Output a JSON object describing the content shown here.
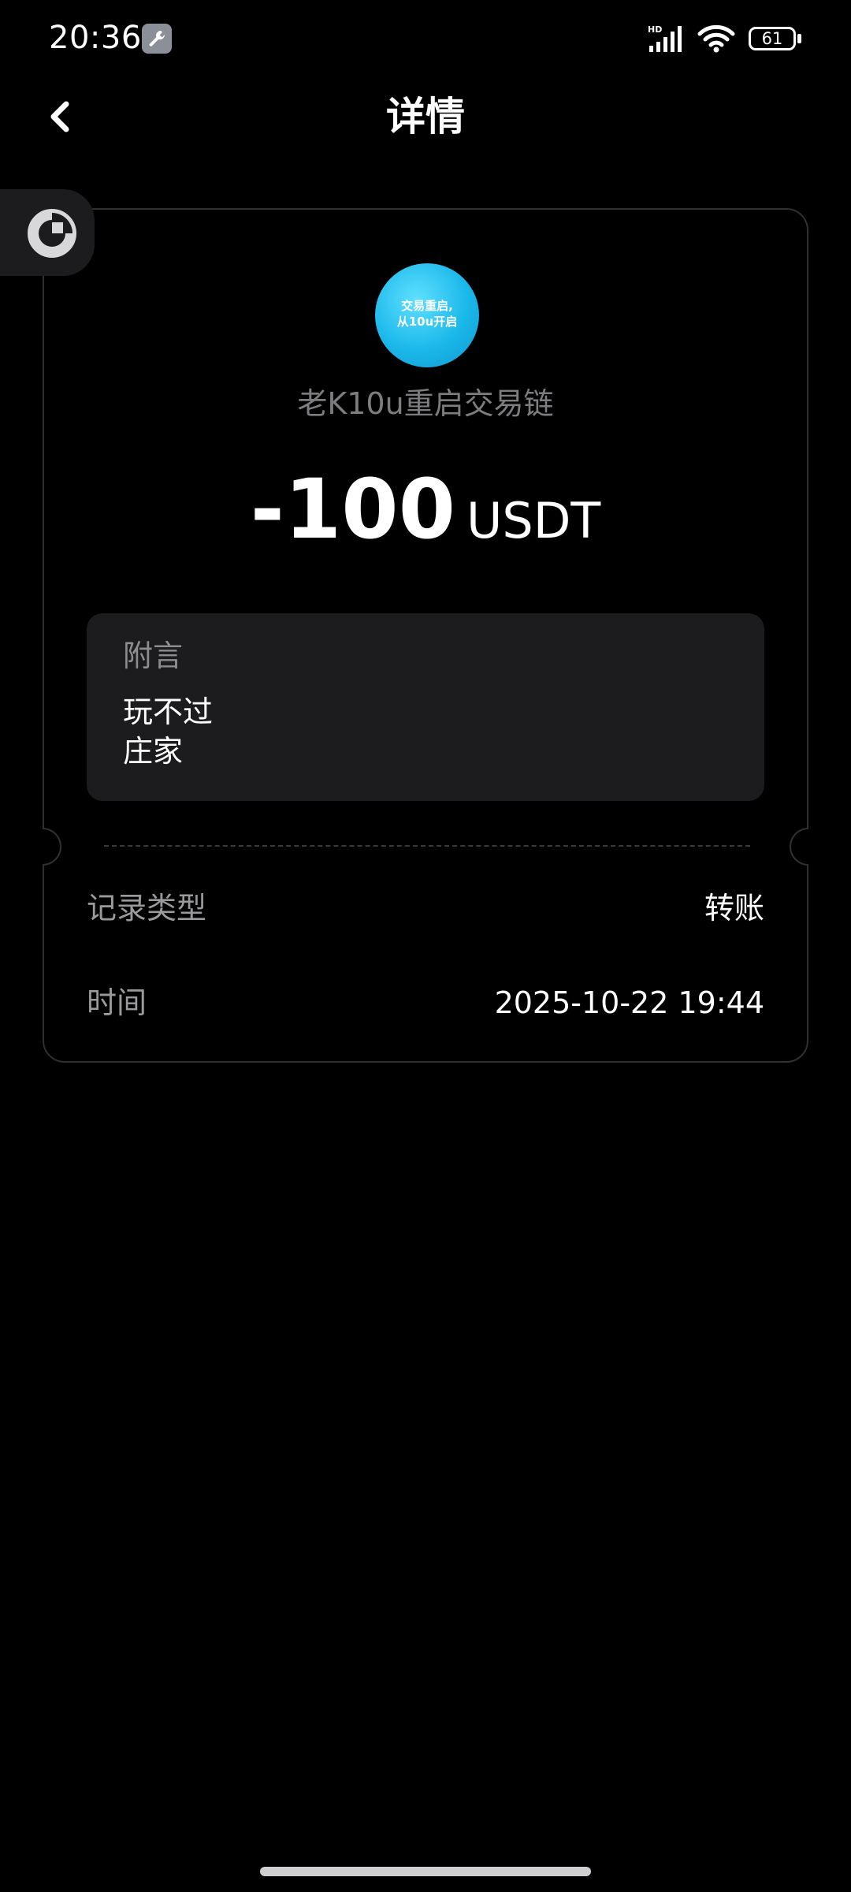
{
  "status_bar": {
    "time": "20:36",
    "network_label": "HD",
    "battery_level": "61",
    "battery_fraction": 0.61
  },
  "header": {
    "title": "详情"
  },
  "ticket": {
    "avatar_text": "交易重启,\n从10u开启",
    "account_name": "老K10u重启交易链",
    "amount": "-100",
    "currency": "USDT",
    "note": {
      "label": "附言",
      "text": "玩不过\n庄家"
    },
    "rows": [
      {
        "label": "记录类型",
        "value": "转账"
      },
      {
        "label": "时间",
        "value": "2025-10-22 19:44"
      }
    ]
  },
  "icons": {
    "status_tool": "wrench-icon",
    "back": "chevron-left-icon",
    "float_widget": "circular-progress-icon"
  },
  "colors": {
    "background": "#000000",
    "card_border": "#303033",
    "note_bg": "#1c1c1e",
    "avatar_blue": "#1bb8ea",
    "muted_text": "#7d7d80"
  }
}
